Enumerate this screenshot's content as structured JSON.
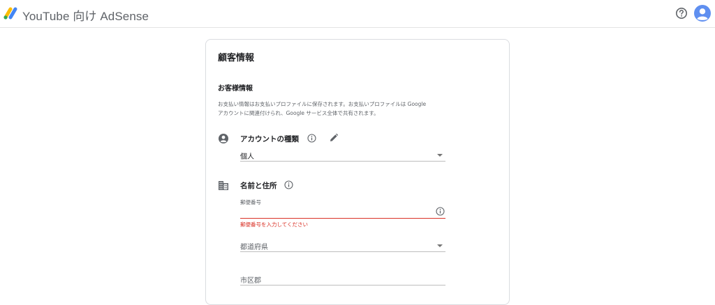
{
  "header": {
    "app_title": "YouTube 向け AdSense",
    "logo_icon": "adsense-logo-icon",
    "help_icon": "help-circle-icon",
    "avatar_icon": "account-avatar-icon",
    "brand_colors": {
      "blue": "#4285F4",
      "yellow": "#FBBC04",
      "green": "#34A853",
      "avatar_bg": "#5f8ff0"
    }
  },
  "card": {
    "title": "顧客情報",
    "section_title": "お客様情報",
    "description_line1": "お支払い情報はお支払いプロファイルに保存されます。お支払いプロファイルは Google",
    "description_line2": "アカウントに関連付けられ、Google サービス全体で共有されます。",
    "account_type": {
      "label": "アカウントの種類",
      "value": "個人",
      "icon": "account-circle-icon"
    },
    "name_address": {
      "label": "名前と住所",
      "icon": "business-icon",
      "postal_code": {
        "label": "郵便番号",
        "value": "",
        "error": "郵便番号を入力してください",
        "error_color": "#d93025"
      },
      "prefecture": {
        "placeholder": "都道府県"
      },
      "city": {
        "placeholder": "市区郡"
      }
    }
  }
}
